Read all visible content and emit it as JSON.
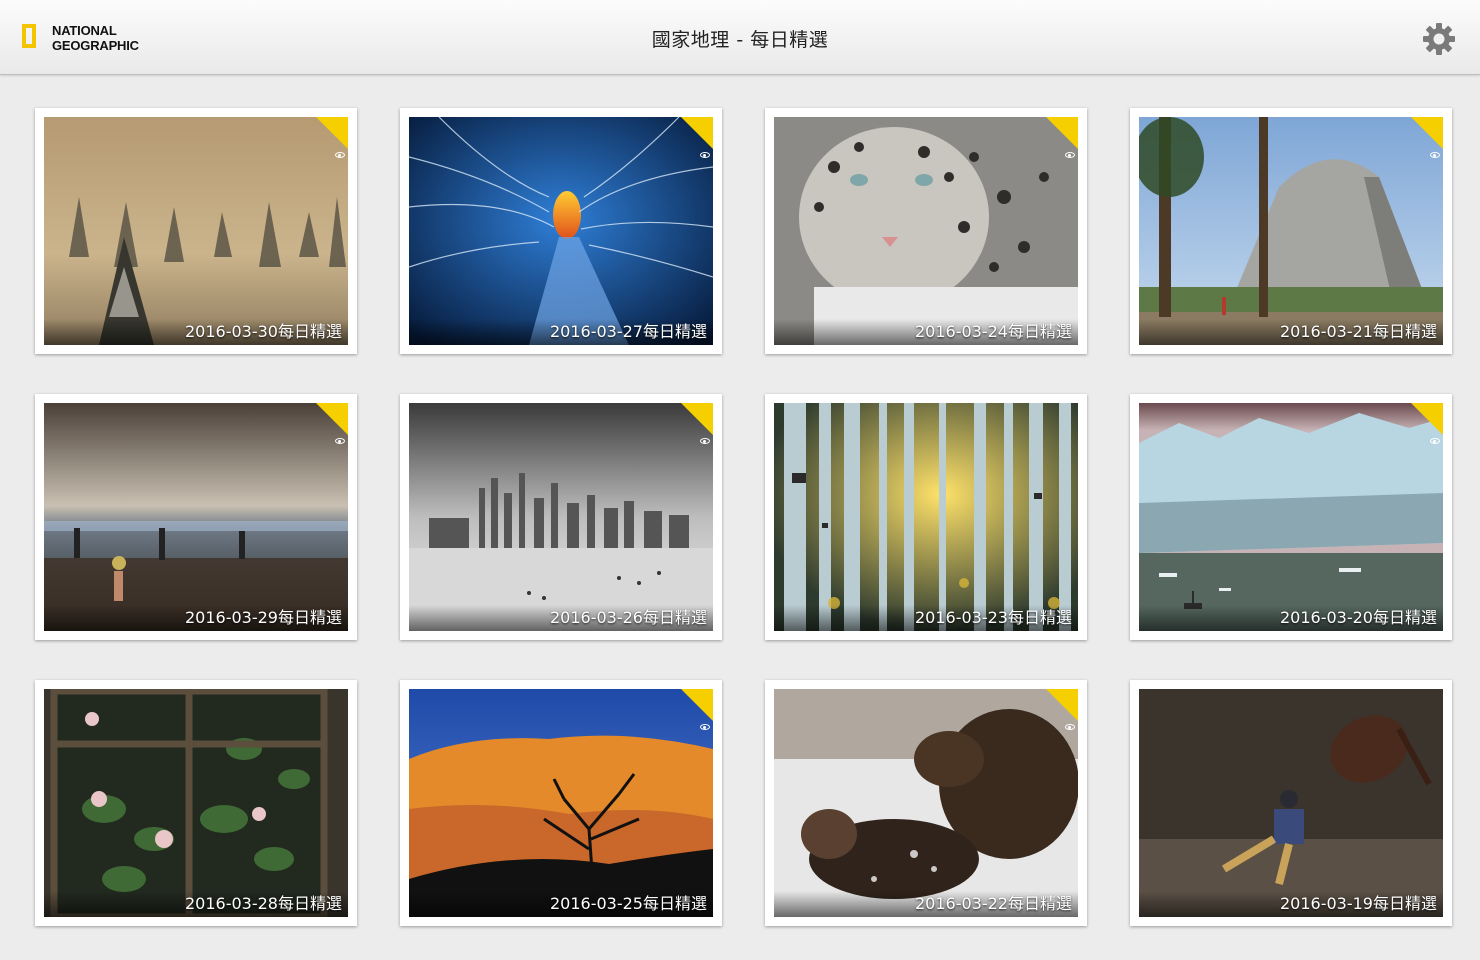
{
  "header": {
    "logo_line1": "NATIONAL",
    "logo_line2": "GEOGRAPHIC",
    "title": "國家地理 - 每日精選",
    "settings_icon": "gear-icon"
  },
  "colors": {
    "badge": "#f6cf00",
    "background": "#ececec"
  },
  "photos": [
    {
      "caption": "2016-03-30每日精選",
      "scene": "foggy-forest",
      "viewed": true
    },
    {
      "caption": "2016-03-27每日精選",
      "scene": "snowy-tunnel",
      "viewed": true
    },
    {
      "caption": "2016-03-24每日精選",
      "scene": "snow-leopard",
      "viewed": true
    },
    {
      "caption": "2016-03-21每日精選",
      "scene": "half-dome",
      "viewed": true
    },
    {
      "caption": "2016-03-29每日精選",
      "scene": "cave-hikers",
      "viewed": true
    },
    {
      "caption": "2016-03-26每日精選",
      "scene": "city-beach",
      "viewed": true
    },
    {
      "caption": "2016-03-23每日精選",
      "scene": "aspen-grove",
      "viewed": true
    },
    {
      "caption": "2016-03-20每日精選",
      "scene": "glacier",
      "viewed": true
    },
    {
      "caption": "2016-03-28每日精選",
      "scene": "window-flowers",
      "viewed": false
    },
    {
      "caption": "2016-03-25每日精選",
      "scene": "desert-tree",
      "viewed": true
    },
    {
      "caption": "2016-03-22每日精選",
      "scene": "bears-snow",
      "viewed": true
    },
    {
      "caption": "2016-03-19每日精選",
      "scene": "rodeo",
      "viewed": false
    }
  ]
}
